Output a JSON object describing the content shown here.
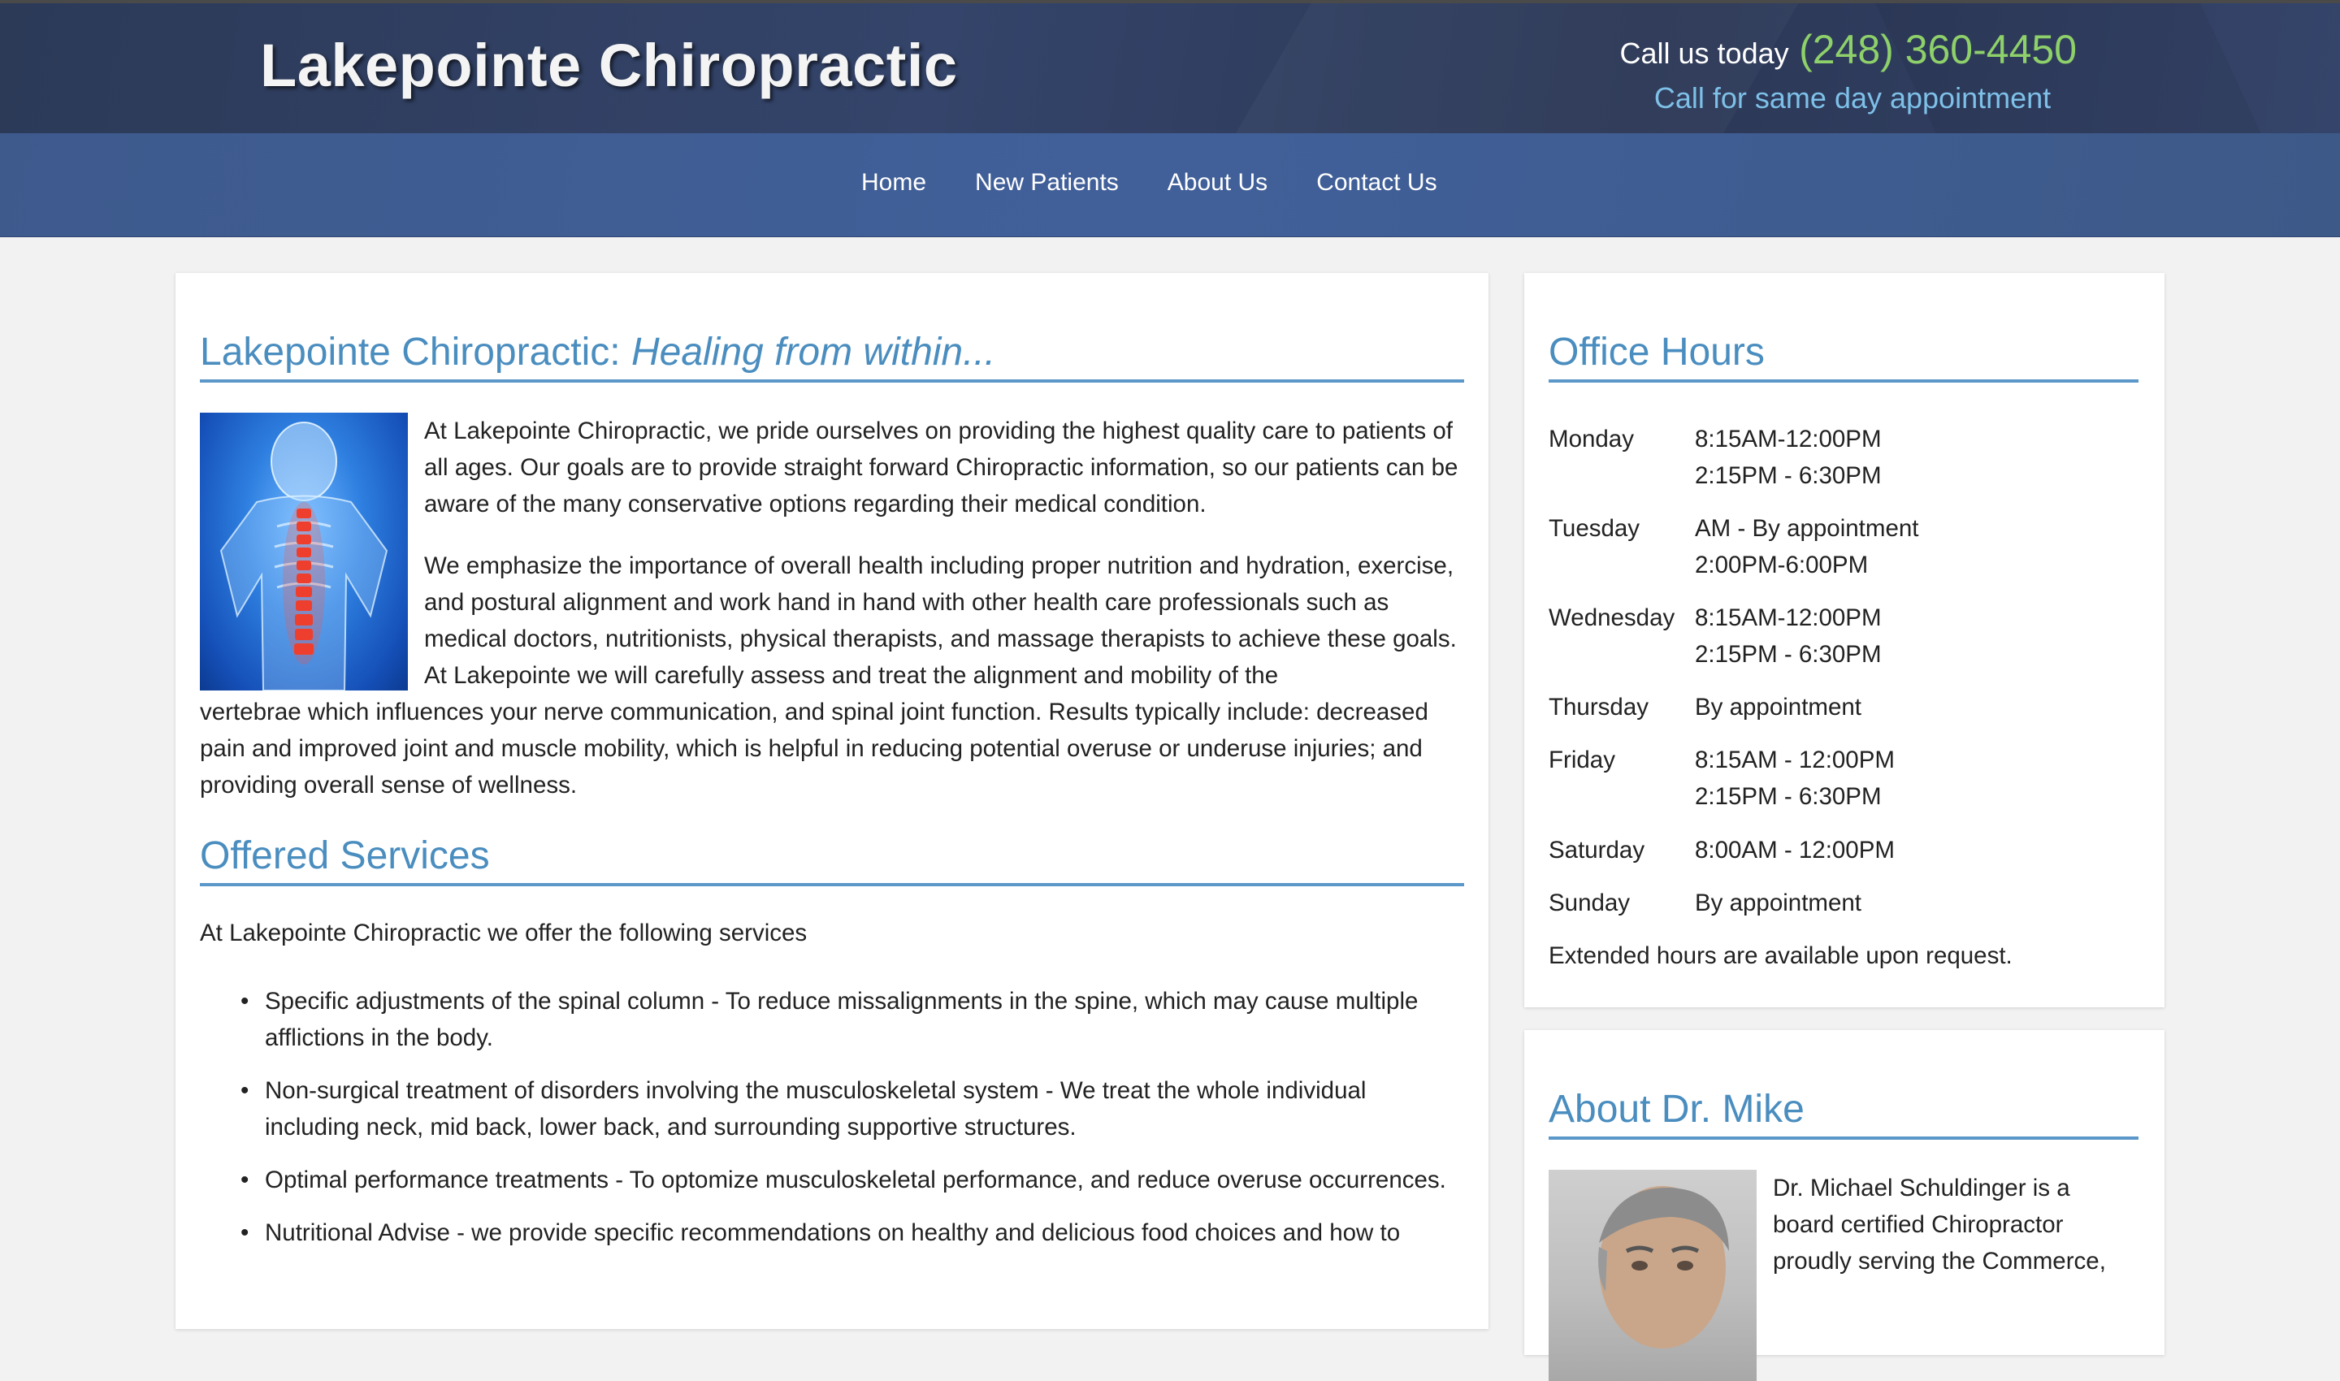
{
  "header": {
    "site_title": "Lakepointe Chiropractic",
    "call_label": "Call us today",
    "phone": "(248) 360-4450",
    "call_sub": "Call for same day appointment"
  },
  "nav": {
    "items": [
      {
        "label": "Home"
      },
      {
        "label": "New Patients"
      },
      {
        "label": "About Us"
      },
      {
        "label": "Contact Us"
      }
    ]
  },
  "main": {
    "intro_heading": "Lakepointe Chiropractic: ",
    "intro_heading_em": "Healing from within...",
    "paragraph1": "At Lakepointe Chiropractic, we pride ourselves on providing the highest quality care to patients of all ages. Our goals are to provide straight forward Chiropractic information, so our patients can be aware of the many conservative options regarding their medical condition.",
    "paragraph2_wrap": "We emphasize the importance of overall health including proper nutrition and hydration, exercise, and postural alignment and work hand in hand with other health care professionals such as medical doctors, nutritionists, physical therapists, and massage therapists to achieve these goals. At Lakepointe we will carefully assess and treat the alignment and mobility of the",
    "paragraph2_full": "vertebrae which influences your nerve communication, and spinal joint function. Results typically include: decreased pain and improved joint and muscle mobility, which is helpful in reducing potential overuse or underuse injuries; and providing overall sense of wellness.",
    "services_heading": "Offered Services",
    "services_intro": "At Lakepointe Chiropractic we offer the following services",
    "services": [
      "Specific adjustments of the spinal column - To reduce missalignments in the spine, which may cause multiple afflictions in the body.",
      "Non-surgical treatment of disorders involving the musculoskeletal system - We treat the whole individual including neck, mid back, lower back, and surrounding supportive structures.",
      "Optimal performance treatments - To optomize musculoskeletal performance, and reduce overuse occurrences.",
      "Nutritional Advise - we provide specific recommendations on healthy and delicious food choices and how to"
    ]
  },
  "hours": {
    "heading": "Office Hours",
    "rows": [
      {
        "day": "Monday",
        "line1": "8:15AM-12:00PM",
        "line2": "2:15PM - 6:30PM"
      },
      {
        "day": "Tuesday",
        "line1": "AM - By appointment",
        "line2": "2:00PM-6:00PM"
      },
      {
        "day": "Wednesday",
        "line1": "8:15AM-12:00PM",
        "line2": "2:15PM - 6:30PM"
      },
      {
        "day": "Thursday",
        "line1": "By appointment",
        "line2": ""
      },
      {
        "day": "Friday",
        "line1": "8:15AM - 12:00PM",
        "line2": "2:15PM - 6:30PM"
      },
      {
        "day": "Saturday",
        "line1": "8:00AM - 12:00PM",
        "line2": ""
      },
      {
        "day": "Sunday",
        "line1": "By appointment",
        "line2": ""
      }
    ],
    "note": "Extended hours are available upon request."
  },
  "about": {
    "heading": "About Dr. Mike",
    "text": "Dr. Michael Schuldinger is a board certified Chiropractor proudly serving the Commerce,"
  },
  "colors": {
    "accent": "#4a8dbf",
    "phone": "#8ed06a",
    "sub": "#7ec0e8"
  }
}
